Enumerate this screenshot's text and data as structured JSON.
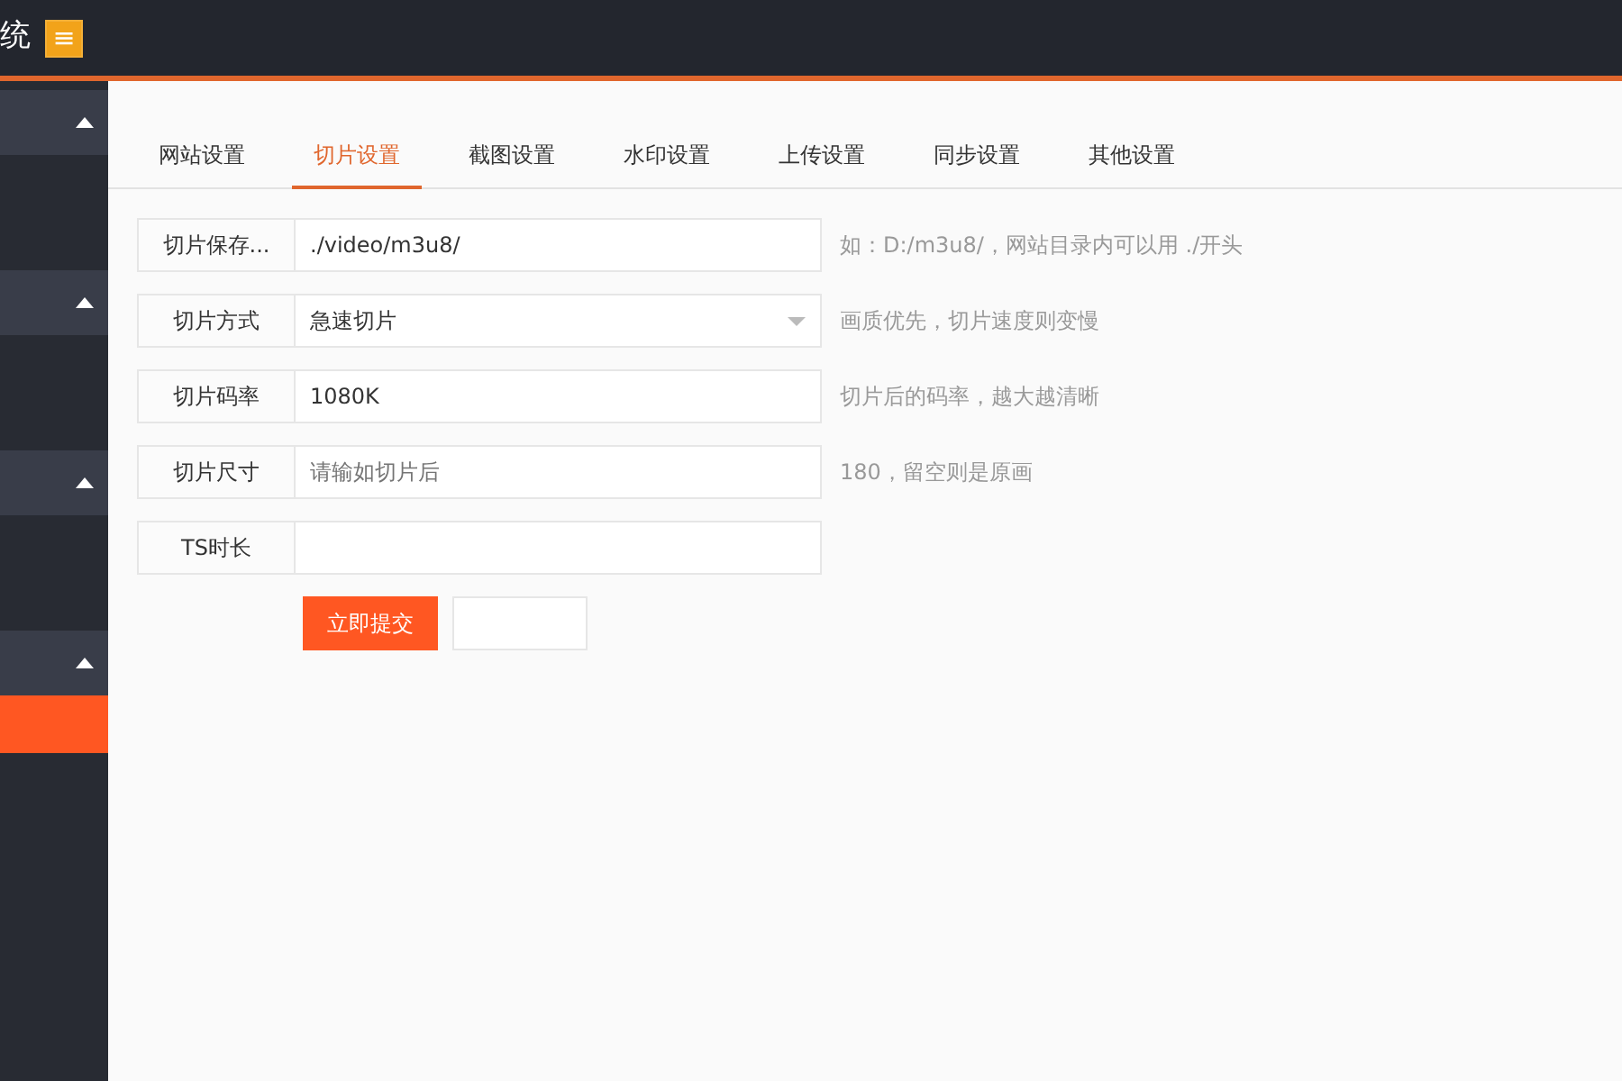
{
  "header": {
    "title": "统",
    "menu_icon": "≡"
  },
  "sidebar": {
    "groups": [
      {
        "expanded": true,
        "items": [
          {
            "selected": false
          }
        ]
      },
      {
        "expanded": true,
        "items": [
          {
            "selected": false
          }
        ]
      },
      {
        "expanded": true,
        "items": [
          {
            "selected": false
          }
        ]
      },
      {
        "expanded": true,
        "items": [
          {
            "selected": true
          }
        ]
      }
    ]
  },
  "tabs": [
    {
      "label": "网站设置",
      "selected": false
    },
    {
      "label": "切片设置",
      "selected": true
    },
    {
      "label": "截图设置",
      "selected": false
    },
    {
      "label": "水印设置",
      "selected": false
    },
    {
      "label": "上传设置",
      "selected": false
    },
    {
      "label": "同步设置",
      "selected": false
    },
    {
      "label": "其他设置",
      "selected": false
    }
  ],
  "form": [
    {
      "kind": "text",
      "label": "切片保存...",
      "value": "./video/m3u8/",
      "hint": "如：D:/m3u8/，网站目录内可以用 ./开头"
    },
    {
      "kind": "select",
      "label": "切片方式",
      "value": "急速切片",
      "hint": "画质优先，切片速度则变慢"
    },
    {
      "kind": "text",
      "label": "切片码率",
      "value": "1080K",
      "hint": "切片后的码率，越大越清晰"
    },
    {
      "kind": "text",
      "label": "切片尺寸",
      "placeholder": "请输如切片后",
      "hint": "180，留空则是原画"
    },
    {
      "kind": "text",
      "label": "TS时长"
    }
  ],
  "buttons": [
    {
      "kind": "primary",
      "label": "立即提交"
    },
    {
      "kind": "plain"
    }
  ]
}
